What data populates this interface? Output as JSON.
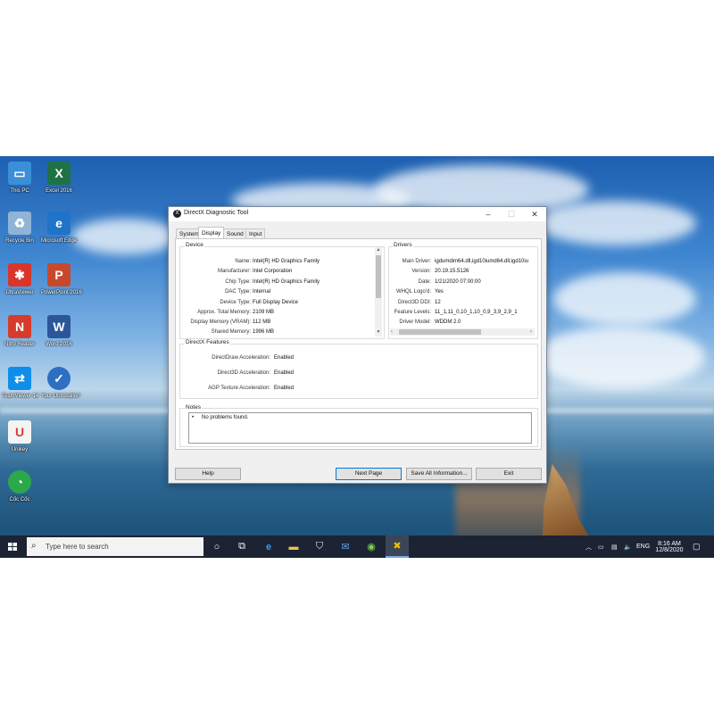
{
  "desktop": {
    "icons": [
      {
        "label": "This PC",
        "icon": "this-pc-icon",
        "color": "#3a8fd8"
      },
      {
        "label": "Excel 2016",
        "icon": "excel-icon",
        "color": "#1f7244"
      },
      {
        "label": "Recycle Bin",
        "icon": "recycle-bin-icon",
        "color": "#8fb4d6"
      },
      {
        "label": "Microsoft Edge",
        "icon": "edge-icon",
        "color": "#1f73c9"
      },
      {
        "label": "UltraViewer",
        "icon": "ultraviewer-icon",
        "color": "#d9352a"
      },
      {
        "label": "PowerPoint 2016",
        "icon": "powerpoint-icon",
        "color": "#c8482b"
      },
      {
        "label": "Nitro Reader",
        "icon": "nitro-icon",
        "color": "#d73b2c"
      },
      {
        "label": "Word 2016",
        "icon": "word-icon",
        "color": "#2b579a"
      },
      {
        "label": "TeamViewer 14",
        "icon": "teamviewer-icon",
        "color": "#0e8ee9"
      },
      {
        "label": "Your Uninstaller!",
        "icon": "uninstaller-icon",
        "color": "#2e6fc4"
      },
      {
        "label": "Unikey",
        "icon": "unikey-icon",
        "color": "#d93b3b"
      },
      {
        "label": "Cốc Cốc",
        "icon": "coccoc-icon",
        "color": "#2aa84a"
      }
    ]
  },
  "window": {
    "title": "DirectX Diagnostic Tool",
    "tabs": [
      "System",
      "Display",
      "Sound",
      "Input"
    ],
    "active_tab": "Display",
    "device": {
      "heading": "Device",
      "rows": [
        {
          "key": "Name:",
          "value": "Intel(R) HD Graphics Family"
        },
        {
          "key": "Manufacturer:",
          "value": "Intel Corporation"
        },
        {
          "key": "Chip Type:",
          "value": "Intel(R) HD Graphics Family"
        },
        {
          "key": "DAC Type:",
          "value": "Internal"
        },
        {
          "key": "Device Type:",
          "value": "Full Display Device"
        },
        {
          "key": "Approx. Total Memory:",
          "value": "2109 MB"
        },
        {
          "key": "Display Memory (VRAM):",
          "value": "112 MB"
        },
        {
          "key": "Shared Memory:",
          "value": "1996 MB"
        }
      ]
    },
    "drivers": {
      "heading": "Drivers",
      "rows": [
        {
          "key": "Main Driver:",
          "value": "igdumdim64.dll,igd10iumd64.dll,igd10iu"
        },
        {
          "key": "Version:",
          "value": "20.19.15.5126"
        },
        {
          "key": "Date:",
          "value": "1/21/2020 07:00:00"
        },
        {
          "key": "WHQL Logo'd:",
          "value": "Yes"
        },
        {
          "key": "Direct3D DDI:",
          "value": "12"
        },
        {
          "key": "Feature Levels:",
          "value": "11_1,11_0,10_1,10_0,9_3,9_2,9_1"
        },
        {
          "key": "Driver Model:",
          "value": "WDDM 2.0"
        }
      ]
    },
    "features": {
      "heading": "DirectX Features",
      "rows": [
        {
          "key": "DirectDraw Acceleration:",
          "value": "Enabled"
        },
        {
          "key": "Direct3D Acceleration:",
          "value": "Enabled"
        },
        {
          "key": "AGP Texture Acceleration:",
          "value": "Enabled"
        }
      ]
    },
    "notes": {
      "heading": "Notes",
      "items": [
        "No problems found."
      ]
    },
    "buttons": {
      "help": "Help",
      "next_page": "Next Page",
      "save_all": "Save All Information...",
      "exit": "Exit"
    }
  },
  "taskbar": {
    "search_placeholder": "Type here to search",
    "language": "ENG",
    "time": "8:16 AM",
    "date": "12/8/2020"
  }
}
